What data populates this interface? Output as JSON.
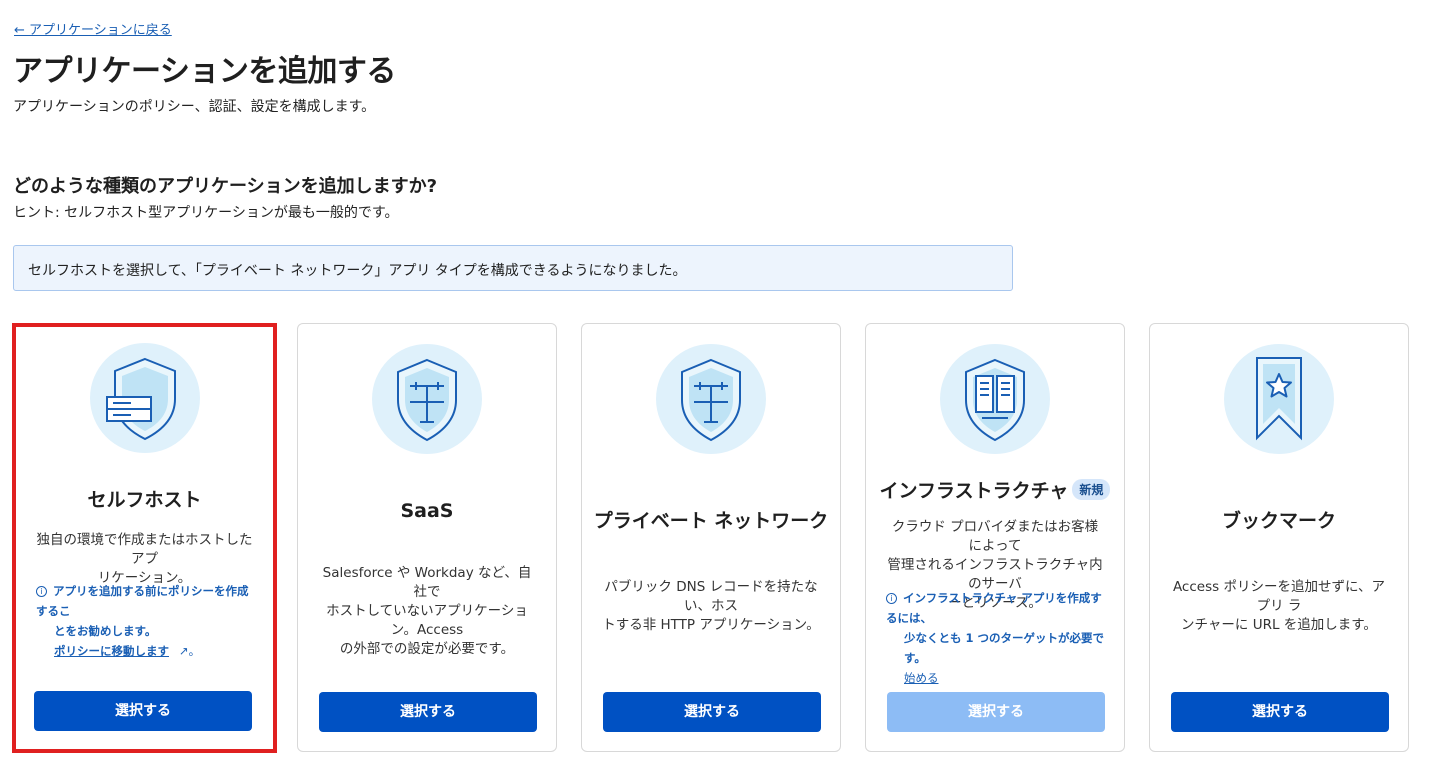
{
  "header": {
    "back_link": "← アプリケーションに戻る",
    "title": "アプリケーションを追加する",
    "description": "アプリケーションのポリシー、認証、設定を構成します。"
  },
  "section": {
    "question": "どのような種類のアプリケーションを追加しますか?",
    "hint": "ヒント: セルフホスト型アプリケーションが最も一般的です。"
  },
  "banner": {
    "text": "セルフホストを選択して、「プライベート ネットワーク」アプリ タイプを構成できるようになりました。"
  },
  "cards": [
    {
      "title": "セルフホスト",
      "icon": "shield-server-icon",
      "desc_line1": "独自の環境で作成またはホストしたアプ",
      "desc_line2": "リケーション。",
      "note_line1": "アプリを追加する前にポリシーを作成するこ",
      "note_line2": "とをお勧めします。",
      "note_link": "ポリシーに移動します",
      "button": "選択する"
    },
    {
      "title": "SaaS",
      "icon": "shield-network-icon",
      "desc_line1": "Salesforce や Workday など、自社で",
      "desc_line2": "ホストしていないアプリケーション。Access",
      "desc_line3": "の外部での設定が必要です。",
      "button": "選択する"
    },
    {
      "title": "プライベート ネットワーク",
      "icon": "shield-network-icon",
      "desc_line1": "パブリック DNS レコードを持たない、ホス",
      "desc_line2": "トする非 HTTP アプリケーション。",
      "button": "選択する"
    },
    {
      "title": "インフラストラクチャ",
      "badge": "新規",
      "icon": "shield-infrastructure-icon",
      "desc_line1": "クラウド プロバイダまたはお客様によって",
      "desc_line2": "管理されるインフラストラクチャ内のサーバ",
      "desc_line3": "ーとリソース。",
      "note_line1": "インフラストラクチャ アプリを作成するには、",
      "note_line2": "少なくとも 1 つのターゲットが必要です。",
      "note_link": "始める",
      "button": "選択する"
    },
    {
      "title": "ブックマーク",
      "icon": "bookmark-star-icon",
      "desc_line1": "Access ポリシーを追加せずに、アプリ ラ",
      "desc_line2": "ンチャーに URL を追加します。",
      "button": "選択する"
    }
  ],
  "colors": {
    "primary": "#0051c3",
    "primary_disabled": "#8dbcf5",
    "highlight_outline": "#e02020",
    "icon_bg": "#dff1fb",
    "link": "#1a5fb4"
  }
}
